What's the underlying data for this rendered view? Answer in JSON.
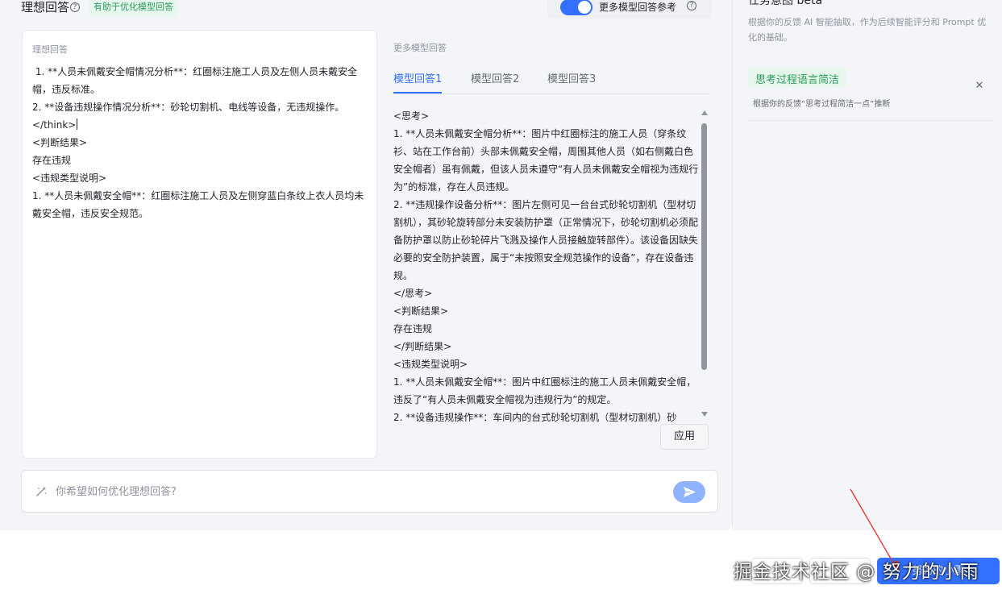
{
  "header": {
    "title": "理想回答",
    "help_icon": "question-circle-icon",
    "badge": "有助于优化模型回答",
    "toggle_label": "更多模型回答参考",
    "toggle_on": true,
    "accent_color": "#3370ff"
  },
  "ideal_answer": {
    "label": "理想回答",
    "text": " 1. **人员未佩戴安全帽情况分析**：红圈标注施工人员及左侧人员未戴安全帽，违反标准。\n2. **设备违规操作情况分析**：砂轮切割机、电线等设备，无违规操作。\n</think>"
  },
  "ideal_answer_rest": {
    "text": "<判断结果>\n存在违规\n<违规类型说明>\n1. **人员未佩戴安全帽**：红圈标注施工人员及左侧穿蓝白条纹上衣人员均未戴安全帽，违反安全规范。"
  },
  "more_models": {
    "label": "更多模型回答",
    "tabs": [
      "模型回答1",
      "模型回答2",
      "模型回答3"
    ],
    "active_tab": 0,
    "answer_text": "<思考>\n1. **人员未佩戴安全帽分析**：图片中红圈标注的施工人员（穿条纹衫、站在工作台前）头部未佩戴安全帽，周围其他人员（如右侧戴白色安全帽者）虽有佩戴，但该人员未遵守“有人员未佩戴安全帽视为违规行为”的标准，存在人员违规。\n2. **违规操作设备分析**：图片左侧可见一台台式砂轮切割机（型材切割机），其砂轮旋转部分未安装防护罩（正常情况下，砂轮切割机必须配备防护罩以防止砂轮碎片飞溅及操作人员接触旋转部件）。该设备因缺失必要的安全防护装置，属于“未按照安全规范操作的设备”，存在设备违规。\n</思考>\n<判断结果>\n存在违规\n</判断结果>\n<违规类型说明>\n1. **人员未佩戴安全帽**：图片中红圈标注的施工人员未佩戴安全帽，违反了“有人员未佩戴安全帽视为违规行为”的规定。\n2. **设备违规操作**：车间内的台式砂轮切割机（型材切割机）砂",
    "apply_label": "应用"
  },
  "prompt": {
    "placeholder": "你希望如何优化理想回答?",
    "value": "",
    "icon": "magic-wand-icon",
    "send_icon": "send-icon"
  },
  "right_panel": {
    "title": "任务意图 beta",
    "description": "根据你的反馈 AI 智能抽取，作为后续智能评分和 Prompt 优化的基础。",
    "items": [
      {
        "tag": "思考过程语言简洁",
        "subtitle": "根据你的反馈“思考过程简洁一点”推断",
        "close_icon": "close-icon"
      }
    ]
  },
  "footer": {
    "primary_label": "努力的小雨",
    "watermark": "掘金技术社区 @ 努力的小雨"
  }
}
